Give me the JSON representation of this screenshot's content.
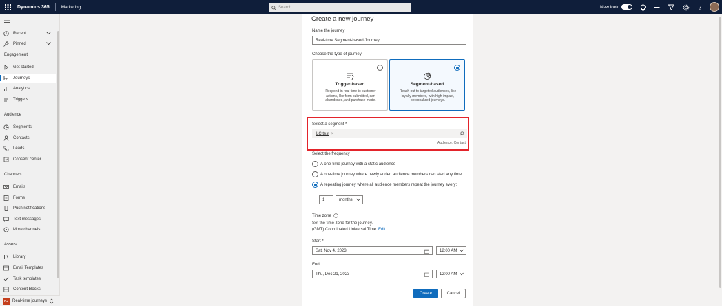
{
  "topbar": {
    "app_title": "Dynamics 365",
    "area": "Marketing",
    "search_placeholder": "Search",
    "new_look_label": "New look"
  },
  "sidebar": {
    "top_items": [
      {
        "label": "Recent",
        "icon": "clock-icon"
      },
      {
        "label": "Pinned",
        "icon": "pin-icon"
      }
    ],
    "groups": [
      {
        "heading": "Engagement",
        "items": [
          "Get started",
          "Journeys",
          "Analytics",
          "Triggers"
        ]
      },
      {
        "heading": "Audience",
        "items": [
          "Segments",
          "Contacts",
          "Leads",
          "Consent center"
        ]
      },
      {
        "heading": "Channels",
        "items": [
          "Emails",
          "Forms",
          "Push notifications",
          "Text messages",
          "More channels"
        ]
      },
      {
        "heading": "Assets",
        "items": [
          "Library",
          "Email Templates",
          "Task templates",
          "Content blocks"
        ]
      }
    ],
    "active_item": "Journeys",
    "area_switcher": {
      "badge": "RJ",
      "label": "Real-time journeys"
    }
  },
  "form": {
    "title": "Create a new journey",
    "name_label": "Name the journey",
    "name_value": "Real-time Segment-based Journey",
    "type_label": "Choose the type of journey",
    "types": [
      {
        "title": "Trigger-based",
        "desc": "Respond in real time to customer actions, like form submitted, cart abandoned, and purchase made.",
        "selected": false
      },
      {
        "title": "Segment-based",
        "desc": "Reach out to targeted audiences, like loyalty members, with high-impact, personalized journeys.",
        "selected": true
      }
    ],
    "segment_label": "Select a segment *",
    "segment_chip": "LC test",
    "segment_chip_remove": "×",
    "audience_note": "Audience: Contact",
    "frequency_label": "Select the frequency",
    "frequency_options": [
      {
        "label": "A one-time journey with a static audience",
        "selected": false
      },
      {
        "label": "A one-time journey where newly added audience members can start any time",
        "selected": false
      },
      {
        "label": "A repeating journey where all audience members repeat the journey every:",
        "selected": true
      }
    ],
    "repeat_count": "1",
    "repeat_unit": "months",
    "timezone_label": "Time zone",
    "timezone_help": "Set the time zone for the journey.",
    "timezone_value": "(GMT) Coordinated Universal Time",
    "timezone_edit": "Edit",
    "start_label": "Start *",
    "start_date": "Sat, Nov 4, 2023",
    "start_time": "12:00 AM",
    "end_label": "End",
    "end_date": "Thu, Dec 21, 2023",
    "end_time": "12:00 AM",
    "create_button": "Create",
    "cancel_button": "Cancel"
  }
}
